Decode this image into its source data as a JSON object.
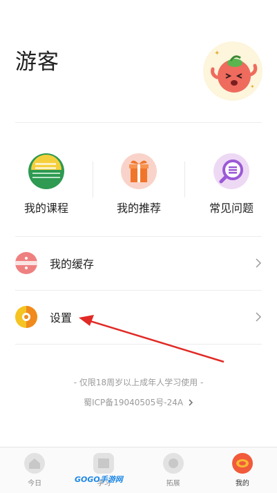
{
  "profile": {
    "username": "游客",
    "avatar_icon": "peach-mascot-avatar"
  },
  "quick_actions": [
    {
      "label": "我的课程",
      "icon": "book-icon"
    },
    {
      "label": "我的推荐",
      "icon": "gift-icon"
    },
    {
      "label": "常见问题",
      "icon": "search-question-icon"
    }
  ],
  "menu": [
    {
      "label": "我的缓存",
      "icon": "cache-icon"
    },
    {
      "label": "设置",
      "icon": "settings-icon"
    }
  ],
  "footer": {
    "notice": "- 仅限18周岁以上成年人学习使用 -",
    "icp": "蜀ICP备19040505号-24A"
  },
  "tabs": [
    {
      "label": "今日",
      "icon": "home-icon"
    },
    {
      "label": "学习",
      "icon": "study-icon"
    },
    {
      "label": "拓展",
      "icon": "explore-icon"
    },
    {
      "label": "我的",
      "icon": "me-icon",
      "active": true
    }
  ],
  "watermark": "GOGO手游网",
  "colors": {
    "accent_red": "#e8453c",
    "book_green": "#2e9a52",
    "gift_orange": "#f0752b",
    "faq_purple": "#9b59d6"
  }
}
